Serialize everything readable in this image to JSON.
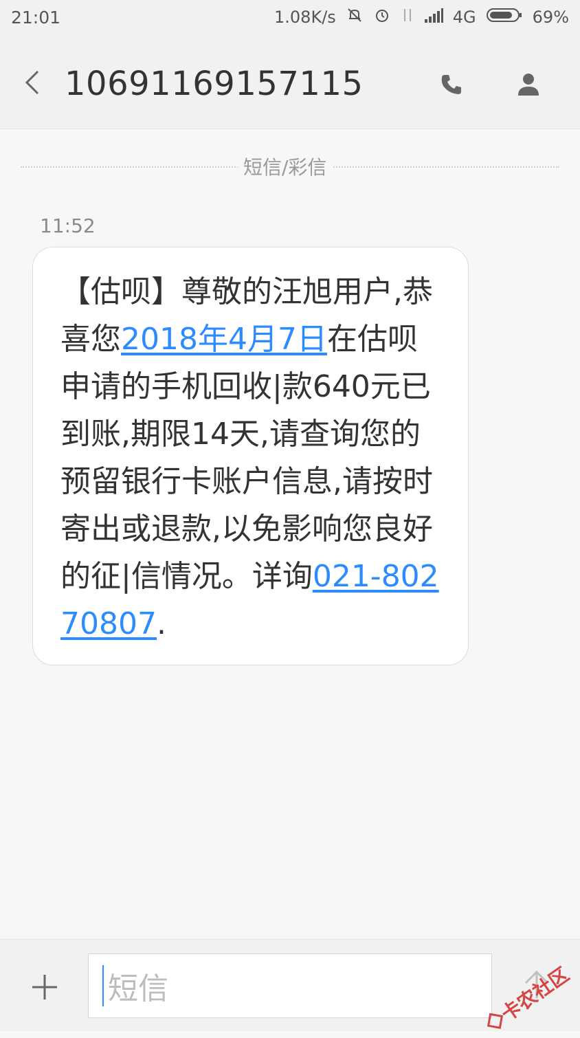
{
  "status_bar": {
    "time": "21:01",
    "speed": "1.08K/s",
    "network": "4G",
    "battery": "69%"
  },
  "header": {
    "title": "10691169157115"
  },
  "conversation": {
    "divider_label": "短信/彩信",
    "time": "11:52",
    "message": {
      "part_1": "【估呗】尊敬的汪旭用户,恭喜您",
      "date_link": "2018年4月7日",
      "part_2": "在估呗申请的手机回收|款640元已到账,期限14天,请查询您的预留银行卡账户信息,请按时寄出或退款,以免影响您良好的征|信情况。详询",
      "phone_link": "021-80270807",
      "part_3": "."
    }
  },
  "compose": {
    "placeholder": "短信"
  },
  "watermark": {
    "text": "卡农社区"
  },
  "colors": {
    "accent": "#2c8cff",
    "background": "#f7f7f7",
    "bar": "#f1f1f1"
  }
}
